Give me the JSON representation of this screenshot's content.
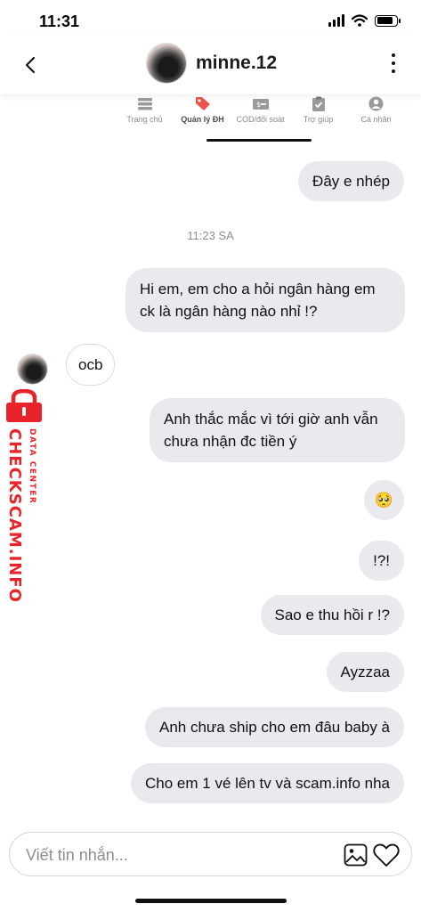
{
  "status_bar": {
    "time": "11:31",
    "battery_level": 0.85,
    "icons": [
      "signal-icon",
      "wifi-icon",
      "battery-icon"
    ]
  },
  "header": {
    "username": "minne.12",
    "icons": [
      "back-chevron-icon",
      "avatar",
      "more-vertical-icon"
    ]
  },
  "app_nav": {
    "items": [
      {
        "label": "Trang chủ",
        "icon": "home-list-icon",
        "active": false
      },
      {
        "label": "Quản lý ĐH",
        "icon": "tag-icon",
        "active": true
      },
      {
        "label": "COD/đối soát",
        "icon": "money-icon",
        "active": false
      },
      {
        "label": "Trợ giúp",
        "icon": "clipboard-check-icon",
        "active": false
      },
      {
        "label": "Cá nhân",
        "icon": "person-icon",
        "active": false
      }
    ],
    "accent": "#e8544a"
  },
  "messages": [
    {
      "text": "Đây e nhép",
      "sender": "me"
    },
    {
      "text": "Hi em, em cho a hỏi ngân hàng em ck là ngân hàng nào nhỉ !?",
      "sender": "me"
    },
    {
      "text": "ocb",
      "sender": "them"
    },
    {
      "text": "Anh thắc mắc vì tới giờ anh vẫn chưa nhận đc tiền ý",
      "sender": "me"
    },
    {
      "text": "🥺",
      "sender": "me"
    },
    {
      "text": "!?!",
      "sender": "me"
    },
    {
      "text": "Sao e thu hồi r !?",
      "sender": "me"
    },
    {
      "text": "Ayzzaa",
      "sender": "me"
    },
    {
      "text": "Anh chưa ship cho em đâu baby à",
      "sender": "me"
    },
    {
      "text": "Cho em 1 vé lên tv và scam.info nha",
      "sender": "me"
    }
  ],
  "timestamp": "11:23 SA",
  "watermark": {
    "title": "CHECKSCAM.INFO",
    "subtitle": "DATA CENTER",
    "color": "#e8232a"
  },
  "composer": {
    "placeholder": "Viết tin nhắn...",
    "value": "",
    "icons": [
      "gallery-icon",
      "heart-icon"
    ]
  },
  "colors": {
    "sent_bubble": "#e9e9ee",
    "received_border": "#dcdcdc",
    "text": "#111111"
  }
}
